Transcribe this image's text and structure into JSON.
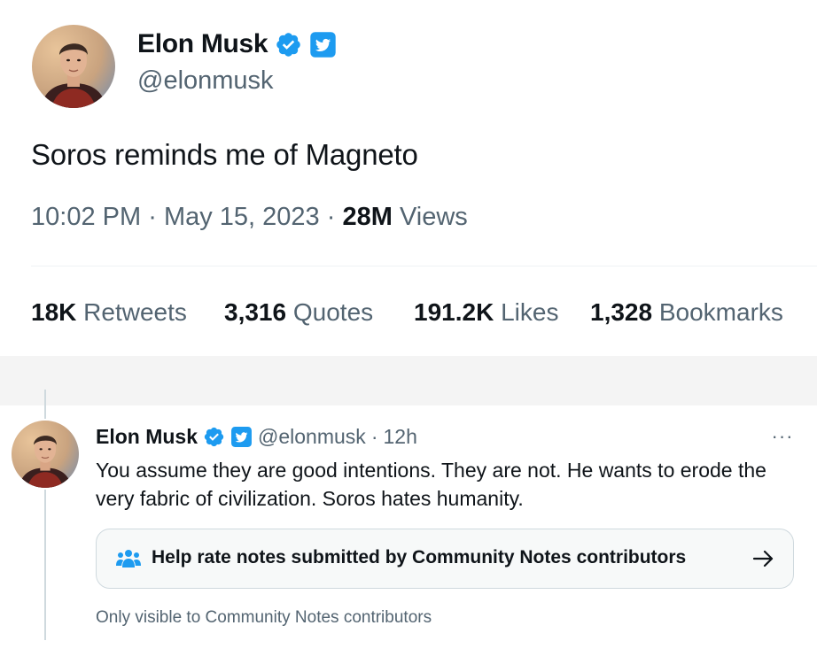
{
  "main_tweet": {
    "display_name": "Elon Musk",
    "handle": "@elonmusk",
    "text": "Soros reminds me of Magneto",
    "time": "10:02 PM",
    "separator": "·",
    "date": "May 15, 2023",
    "views_count": "28M",
    "views_label": "Views",
    "stats": {
      "retweets_count": "18K",
      "retweets_label": "Retweets",
      "quotes_count": "3,316",
      "quotes_label": "Quotes",
      "likes_count": "191.2K",
      "likes_label": "Likes",
      "bookmarks_count": "1,328",
      "bookmarks_label": "Bookmarks"
    }
  },
  "reply": {
    "display_name": "Elon Musk",
    "handle": "@elonmusk",
    "separator": "·",
    "time": "12h",
    "more_label": "···",
    "text": "You assume they are good intentions. They are not. He wants to erode the very fabric of civilization. Soros hates humanity.",
    "community_notes": {
      "label": "Help rate notes submitted by Community Notes contributors",
      "icon": "people-icon",
      "arrow": "arrow-right-icon"
    },
    "visibility_note": "Only visible to Community Notes contributors"
  },
  "colors": {
    "accent": "#1d9bf0",
    "text_primary": "#0f1419",
    "text_secondary": "#536471",
    "border": "#cfd9de"
  }
}
